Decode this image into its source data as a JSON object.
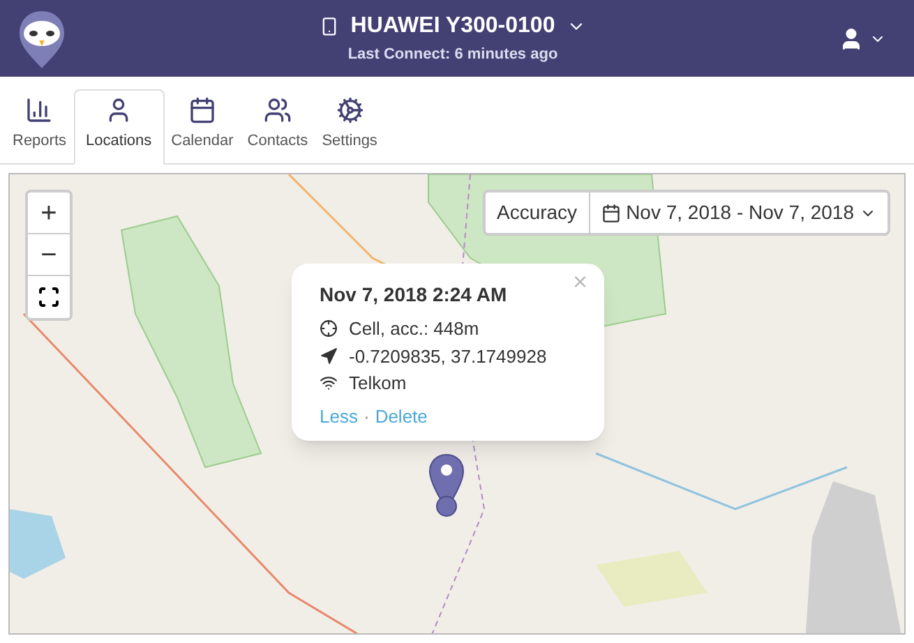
{
  "header": {
    "device": "HUAWEI Y300-0100",
    "last_connect": "Last Connect: 6 minutes ago"
  },
  "tabs": [
    {
      "label": "Reports",
      "selected": false
    },
    {
      "label": "Locations",
      "selected": true
    },
    {
      "label": "Calendar",
      "selected": false
    },
    {
      "label": "Contacts",
      "selected": false
    },
    {
      "label": "Settings",
      "selected": false
    }
  ],
  "map": {
    "zoom_in": "+",
    "zoom_out": "−",
    "accuracy": "Accuracy",
    "date_range": "Nov 7, 2018 - Nov 7, 2018",
    "popup": {
      "close": "×",
      "time": "Nov 7, 2018 2:24 AM",
      "source": "Cell, acc.: 448m",
      "coordinates": "-0.7209835, 37.1749928",
      "network": "Telkom",
      "less": "Less",
      "separator": "·",
      "delete": "Delete"
    }
  }
}
